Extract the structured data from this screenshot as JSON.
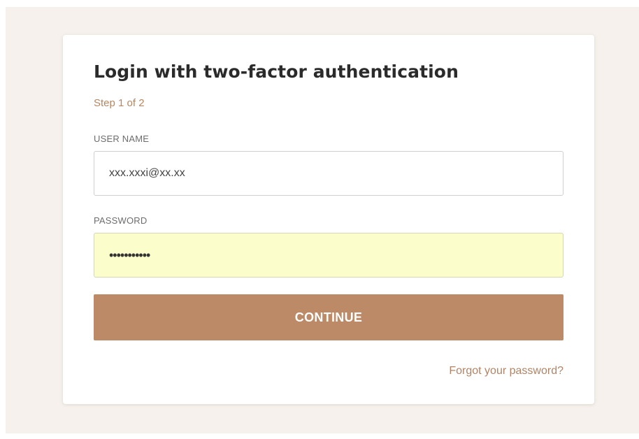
{
  "login": {
    "title": "Login with two-factor authentication",
    "step": "Step 1 of 2",
    "username": {
      "label": "USER NAME",
      "value": "xxx.xxxi@xx.xx"
    },
    "password": {
      "label": "PASSWORD",
      "masked_value": "•••••••••••"
    },
    "continue_label": "CONTINUE",
    "forgot_password": "Forgot your password?"
  },
  "colors": {
    "page_background": "#f6f1ed",
    "accent": "#bc8a66",
    "step_text": "#b78560",
    "autofill_background": "#fbfdcb"
  }
}
